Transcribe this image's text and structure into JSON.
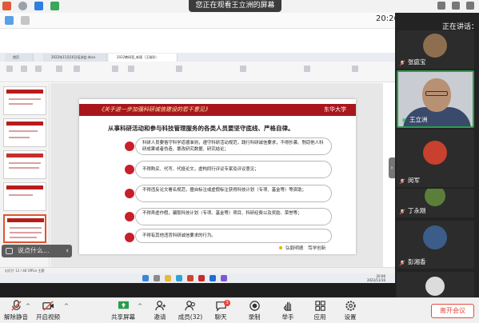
{
  "banner": {
    "sharing_notice": "您正在观看王立洲的屏幕"
  },
  "toolbar_time": "20:26",
  "shared_screen": {
    "tabs": [
      "首页",
      "2022年11月16日培训会.docx",
      "2022教研室_新版（王瑞珍）"
    ],
    "statusline": "幻灯片 12 / 48   Office 主题",
    "taskbar_time": "20:06\n2022/11/16",
    "slide": {
      "title": "《关于进一步加强科研诚信建设的若干意见》",
      "logo": "东华大学",
      "subtitle": "从事科研活动和参与科技管理服务的各类人员要坚守底线、严格自律。",
      "rules": [
        "科研人员要恪守科学道德准则，遵守科研活动规范，践行科研诚信要求，不得抄袭、剽窃他人科研成果或者伪造、篡改研究数据、研究结论；",
        "不得购买、代写、代投论文，虚构同行评议专家及评议意见；",
        "不得违反论文署名规范，擅自标注或虚假标注获得科技计划（专项、基金等）等资助；",
        "不得弄虚作假，骗取科技计划（专项、基金等）项目、科研经费以及奖励、荣誉等；",
        "不得有其他违背科研诚信要求的行为。"
      ],
      "slogan": "弘毅明德　笃学创新"
    },
    "danmaku_placeholder": "说点什么..."
  },
  "participants_panel": {
    "speaking_label": "正在讲话：",
    "participants": [
      {
        "name": "张庭宝",
        "muted": true
      },
      {
        "name": "王立洲",
        "muted": false,
        "speaking": true
      },
      {
        "name": "闵军",
        "muted": true
      },
      {
        "name": "丁永刚",
        "muted": true
      },
      {
        "name": "彭湘香",
        "muted": true
      }
    ]
  },
  "bottom_bar": {
    "unmute": "解除静音",
    "video": "开启视频",
    "share": "共享屏幕",
    "invite": "邀请",
    "members": "成员(32)",
    "chat": "聊天",
    "chat_badge": "3",
    "record": "录制",
    "raise_hand": "举手",
    "apps": "应用",
    "settings": "设置",
    "leave": "离开会议"
  },
  "colors": {
    "slide_red": "#a8161b",
    "leave_red": "#e34c3e",
    "active_green": "#2a9d4a"
  }
}
